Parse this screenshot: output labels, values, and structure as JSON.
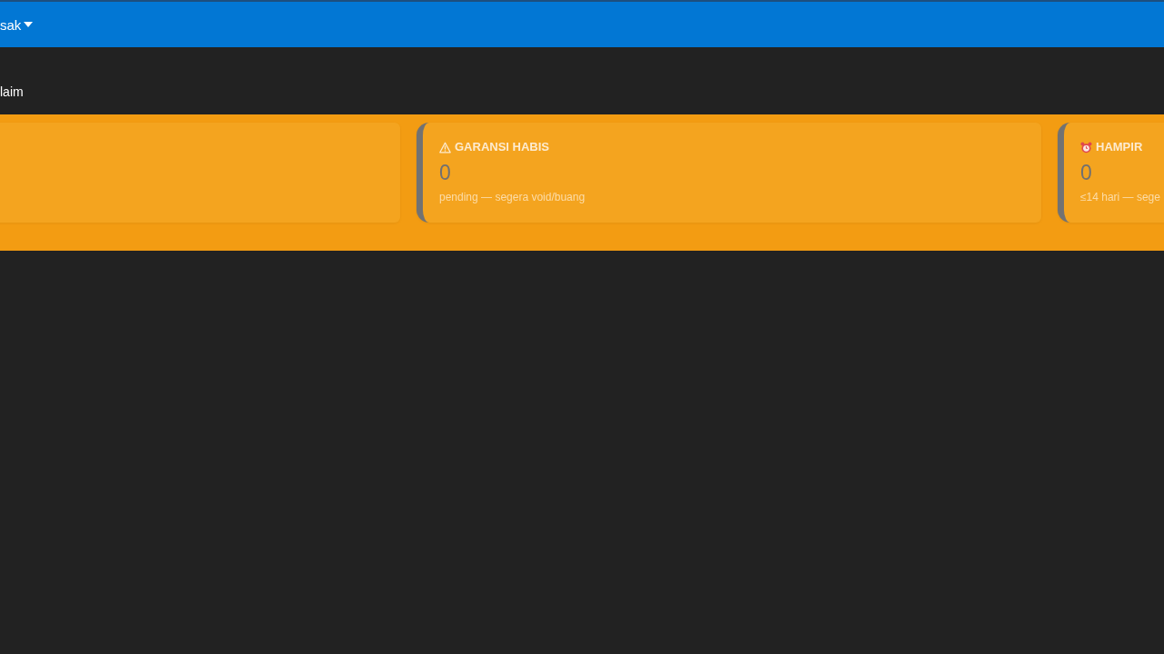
{
  "navbar": {
    "menu": {
      "label": "sak"
    }
  },
  "section_title": "laim",
  "cards": [
    {
      "kind": "blank"
    },
    {
      "kind": "warning",
      "title": "GARANSI HABIS",
      "value": "0",
      "note": "pending — segera void/buang"
    },
    {
      "kind": "alarm",
      "title": "HAMPIR",
      "value": "0",
      "note": "≤14 hari — sege"
    }
  ]
}
